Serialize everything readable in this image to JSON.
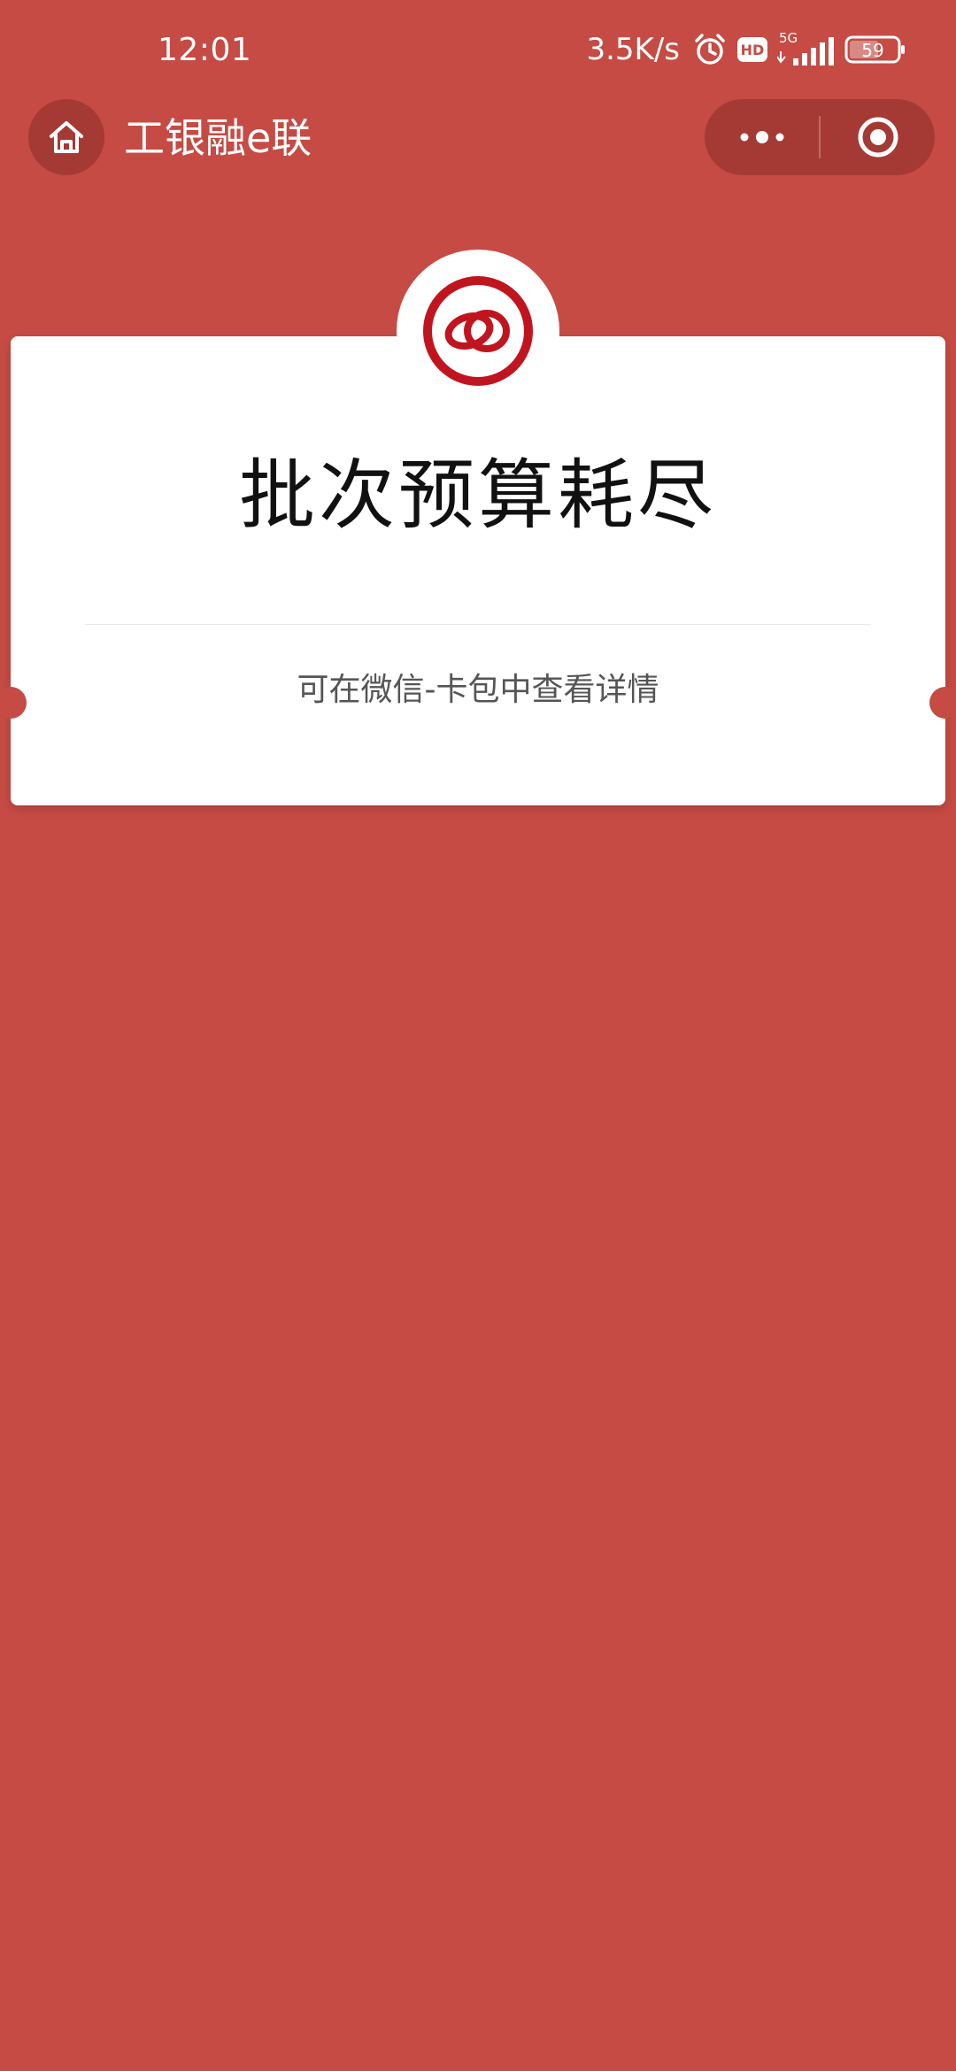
{
  "status_bar": {
    "time": "12:01",
    "net_speed": "3.5K/s",
    "network": "5G",
    "battery": "59",
    "icons": [
      "alarm-icon",
      "hd-icon",
      "signal-icon",
      "battery-icon"
    ]
  },
  "nav": {
    "title": "工银融e联",
    "home_icon": "home-icon",
    "more_icon": "more-icon",
    "close_icon": "close-target-icon"
  },
  "card": {
    "logo_icon": "icbc-logo-icon",
    "title": "批次预算耗尽",
    "hint": "可在微信-卡包中查看详情"
  },
  "colors": {
    "background": "#c54b44",
    "capsule": "#a53a34",
    "logo": "#c0151f",
    "card": "#ffffff"
  }
}
